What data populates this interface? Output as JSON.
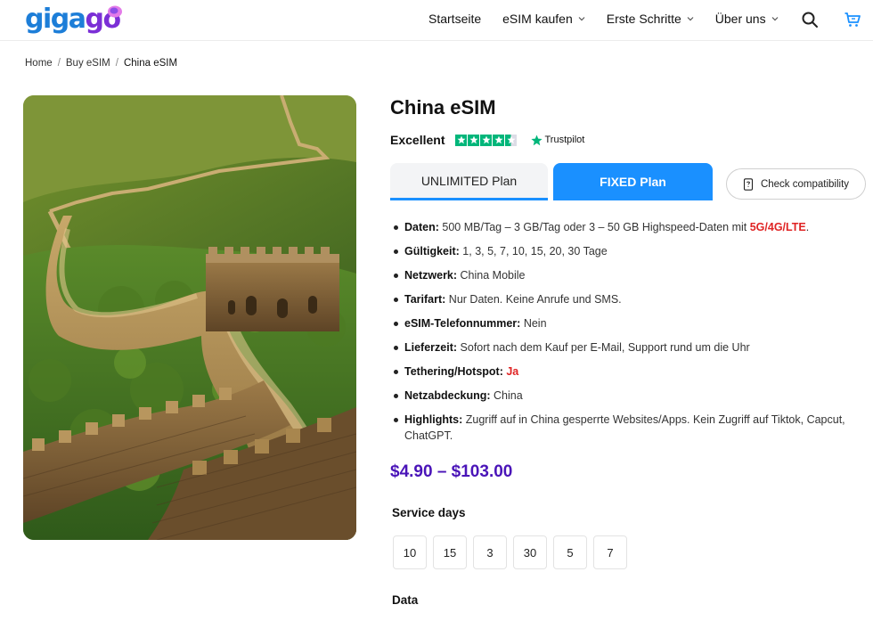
{
  "header": {
    "logo": "gigago",
    "nav": [
      {
        "label": "Startseite",
        "dropdown": false
      },
      {
        "label": "eSIM kaufen",
        "dropdown": true
      },
      {
        "label": "Erste Schritte",
        "dropdown": true
      },
      {
        "label": "Über uns",
        "dropdown": true
      }
    ],
    "icons": [
      "search-icon",
      "cart-icon"
    ]
  },
  "breadcrumb": {
    "items": [
      "Home",
      "Buy eSIM",
      "China eSIM"
    ],
    "separator": "/"
  },
  "product": {
    "title": "China eSIM",
    "image_alt": "Great Wall of China",
    "rating": {
      "label": "Excellent",
      "stars": 4.5,
      "provider": "Trustpilot"
    },
    "tabs": {
      "unlimited": "UNLIMITED Plan",
      "fixed": "FIXED Plan",
      "active": "fixed"
    },
    "check_compatibility": "Check compatibility",
    "features": [
      {
        "key": "Daten:",
        "value": "500 MB/Tag – 3 GB/Tag oder 3 – 50 GB Highspeed-Daten mit ",
        "highlight": "5G/4G/LTE",
        "suffix": "."
      },
      {
        "key": "Gültigkeit:",
        "value": "1, 3, 5, 7, 10, 15, 20, 30 Tage"
      },
      {
        "key": "Netzwerk:",
        "value": "China Mobile"
      },
      {
        "key": "Tarifart:",
        "value": "Nur Daten. Keine Anrufe und SMS."
      },
      {
        "key": "eSIM-Telefonnummer:",
        "value": "Nein"
      },
      {
        "key": "Lieferzeit:",
        "value": "Sofort nach dem Kauf per E-Mail, Support rund um die Uhr"
      },
      {
        "key": "Tethering/Hotspot:",
        "value": "",
        "highlight": "Ja"
      },
      {
        "key": "Netzabdeckung:",
        "value": "China"
      },
      {
        "key": "Highlights:",
        "value": "Zugriff auf in China gesperrte Websites/Apps. Kein Zugriff auf Tiktok, Capcut, ChatGPT."
      }
    ],
    "price_range": "$4.90 – $103.00",
    "service_days_label": "Service days",
    "service_days": [
      "10",
      "15",
      "3",
      "30",
      "5",
      "7"
    ],
    "data_label": "Data"
  },
  "colors": {
    "brand_blue": "#1a90ff",
    "price_purple": "#4a14b8",
    "highlight_red": "#e02424",
    "trustpilot_green": "#00b67a"
  }
}
